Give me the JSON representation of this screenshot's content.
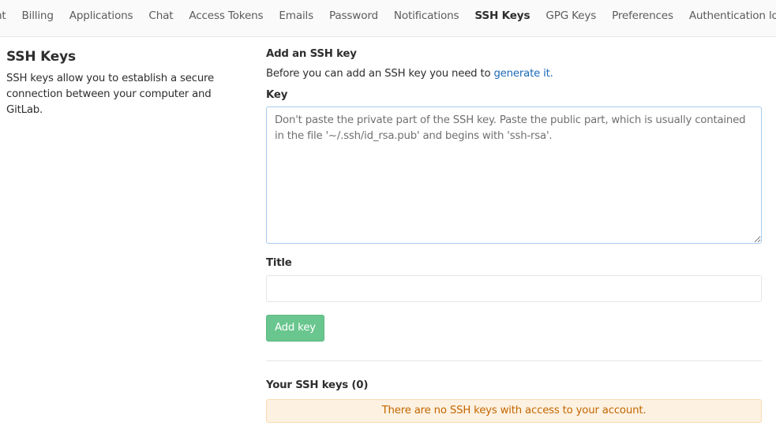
{
  "nav": {
    "tabs": [
      {
        "label": "Account",
        "active": false
      },
      {
        "label": "Billing",
        "active": false
      },
      {
        "label": "Applications",
        "active": false
      },
      {
        "label": "Chat",
        "active": false
      },
      {
        "label": "Access Tokens",
        "active": false
      },
      {
        "label": "Emails",
        "active": false
      },
      {
        "label": "Password",
        "active": false
      },
      {
        "label": "Notifications",
        "active": false
      },
      {
        "label": "SSH Keys",
        "active": true
      },
      {
        "label": "GPG Keys",
        "active": false
      },
      {
        "label": "Preferences",
        "active": false
      },
      {
        "label": "Authentication log",
        "active": false
      }
    ],
    "accent_color": "#1f78d1"
  },
  "sidebar": {
    "title": "SSH Keys",
    "description": "SSH keys allow you to establish a secure connection between your computer and GitLab."
  },
  "form": {
    "heading": "Add an SSH key",
    "intro_text": "Before you can add an SSH key you need to ",
    "intro_link": "generate it.",
    "key_label": "Key",
    "key_value": "",
    "key_placeholder": "Don't paste the private part of the SSH key. Paste the public part, which is usually contained in the file '~/.ssh/id_rsa.pub' and begins with 'ssh-rsa'.",
    "title_label": "Title",
    "title_value": "",
    "title_placeholder": "",
    "submit_label": "Add key",
    "submit_color": "#69c68e"
  },
  "keys_list": {
    "heading": "Your SSH keys (0)",
    "count": 0,
    "empty_message": "There are no SSH keys with access to your account."
  }
}
